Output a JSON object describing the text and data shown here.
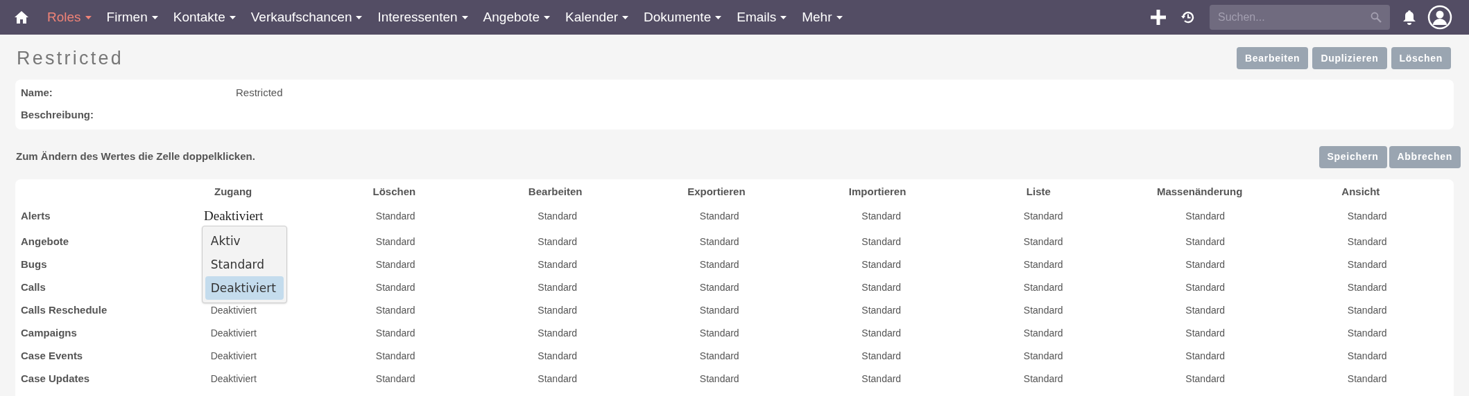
{
  "nav": {
    "items": [
      {
        "label": "Roles",
        "selected": true
      },
      {
        "label": "Firmen",
        "selected": false
      },
      {
        "label": "Kontakte",
        "selected": false
      },
      {
        "label": "Verkaufschancen",
        "selected": false
      },
      {
        "label": "Interessenten",
        "selected": false
      },
      {
        "label": "Angebote",
        "selected": false
      },
      {
        "label": "Kalender",
        "selected": false
      },
      {
        "label": "Dokumente",
        "selected": false
      },
      {
        "label": "Emails",
        "selected": false
      },
      {
        "label": "Mehr",
        "selected": false
      }
    ],
    "search": {
      "placeholder": "Suchen..."
    }
  },
  "title": "Restricted",
  "actions": [
    "Bearbeiten",
    "Duplizieren",
    "Löschen"
  ],
  "details": [
    {
      "label": "Name:",
      "value": "Restricted"
    },
    {
      "label": "Beschreibung:"
    }
  ],
  "hint": "Zum Ändern des Wertes die Zelle doppelklicken.",
  "table_actions": [
    "Speichern",
    "Abbrechen"
  ],
  "table": {
    "columns": [
      "Zugang",
      "Löschen",
      "Bearbeiten",
      "Exportieren",
      "Importieren",
      "Liste",
      "Massenänderung",
      "Ansicht"
    ],
    "rows": [
      {
        "label": "Alerts",
        "zugang": "Deaktiviert",
        "editing": true,
        "options": [
          {
            "label": "Aktiv",
            "selected": false
          },
          {
            "label": "Standard",
            "selected": false
          },
          {
            "label": "Deaktiviert",
            "selected": true
          }
        ],
        "rights": [
          "Standard",
          "Standard",
          "Standard",
          "Standard",
          "Standard",
          "Standard",
          "Standard"
        ]
      },
      {
        "label": "Angebote",
        "editing": false,
        "rights": [
          "Standard",
          "Standard",
          "Standard",
          "Standard",
          "Standard",
          "Standard",
          "Standard"
        ]
      },
      {
        "label": "Bugs",
        "editing": false,
        "rights": [
          "Standard",
          "Standard",
          "Standard",
          "Standard",
          "Standard",
          "Standard",
          "Standard"
        ]
      },
      {
        "label": "Calls",
        "editing": false,
        "rights": [
          "Standard",
          "Standard",
          "Standard",
          "Standard",
          "Standard",
          "Standard",
          "Standard"
        ]
      },
      {
        "label": "Calls Reschedule",
        "zugang": "Deaktiviert",
        "editing": false,
        "rights": [
          "Standard",
          "Standard",
          "Standard",
          "Standard",
          "Standard",
          "Standard",
          "Standard"
        ]
      },
      {
        "label": "Campaigns",
        "zugang": "Deaktiviert",
        "editing": false,
        "rights": [
          "Standard",
          "Standard",
          "Standard",
          "Standard",
          "Standard",
          "Standard",
          "Standard"
        ]
      },
      {
        "label": "Case Events",
        "zugang": "Deaktiviert",
        "editing": false,
        "rights": [
          "Standard",
          "Standard",
          "Standard",
          "Standard",
          "Standard",
          "Standard",
          "Standard"
        ]
      },
      {
        "label": "Case Updates",
        "zugang": "Deaktiviert",
        "editing": false,
        "rights": [
          "Standard",
          "Standard",
          "Standard",
          "Standard",
          "Standard",
          "Standard",
          "Standard"
        ]
      }
    ]
  }
}
